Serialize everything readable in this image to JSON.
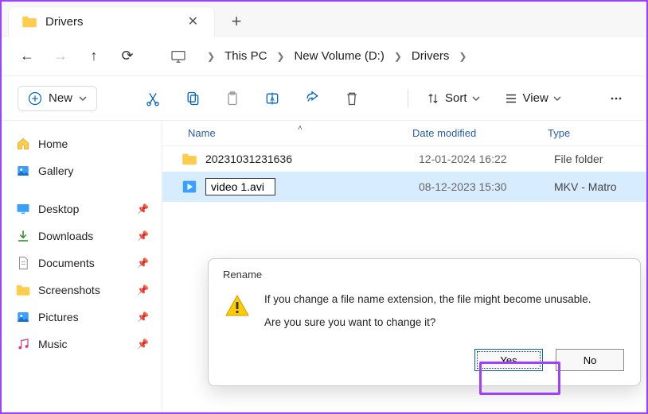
{
  "tab": {
    "title": "Drivers"
  },
  "breadcrumb": [
    "This PC",
    "New Volume (D:)",
    "Drivers"
  ],
  "toolbar": {
    "new_label": "New",
    "sort_label": "Sort",
    "view_label": "View"
  },
  "columns": {
    "name": "Name",
    "date": "Date modified",
    "type": "Type"
  },
  "sidebar": {
    "home": "Home",
    "gallery": "Gallery",
    "items": [
      {
        "label": "Desktop",
        "pinned": true
      },
      {
        "label": "Downloads",
        "pinned": true
      },
      {
        "label": "Documents",
        "pinned": true
      },
      {
        "label": "Screenshots",
        "pinned": true
      },
      {
        "label": "Pictures",
        "pinned": true
      },
      {
        "label": "Music",
        "pinned": true
      }
    ]
  },
  "files": [
    {
      "name": "20231031231636",
      "date": "12-01-2024 16:22",
      "type": "File folder",
      "kind": "folder"
    },
    {
      "name": "video 1.avi",
      "date": "08-12-2023 15:30",
      "type": "MKV - Matro",
      "kind": "video",
      "renaming": true
    }
  ],
  "dialog": {
    "title": "Rename",
    "line1": "If you change a file name extension, the file might become unusable.",
    "line2": "Are you sure you want to change it?",
    "yes": "Yes",
    "no": "No"
  }
}
